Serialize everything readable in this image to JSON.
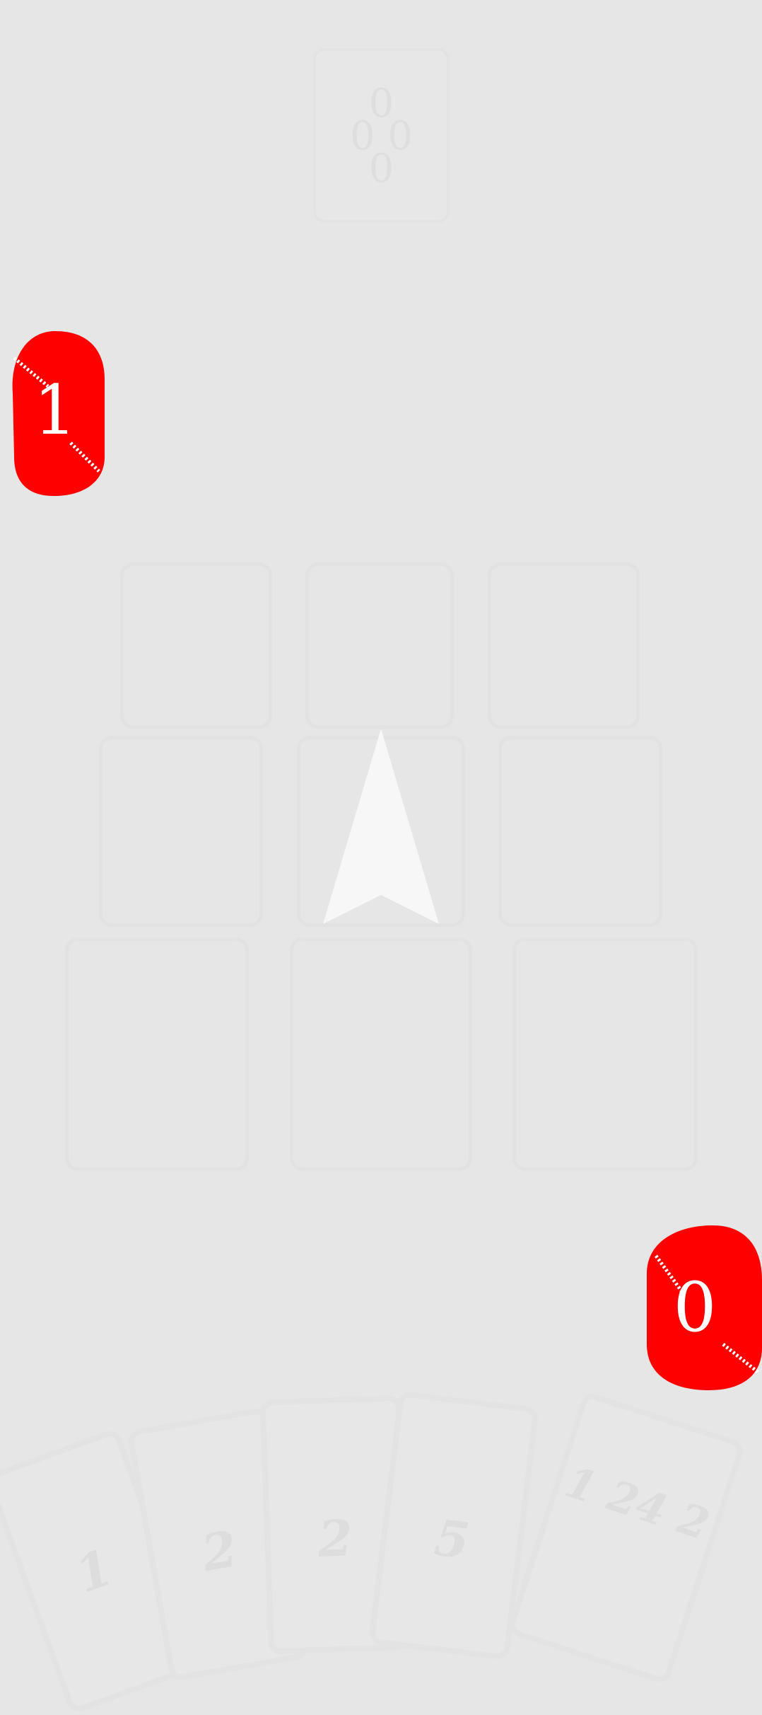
{
  "opponent_card": {
    "digits": [
      "0",
      "0 0",
      "0"
    ]
  },
  "tokens": {
    "left_score": "1",
    "right_score": "0",
    "color": "#ff0000"
  },
  "board": {
    "rows": 3,
    "cols": 3,
    "center_icon": "arrow-up-icon"
  },
  "hand": {
    "cards": [
      {
        "label": "1"
      },
      {
        "label": "2"
      },
      {
        "label": "2"
      },
      {
        "label": "5"
      },
      {
        "label": "1 24 2"
      }
    ]
  }
}
